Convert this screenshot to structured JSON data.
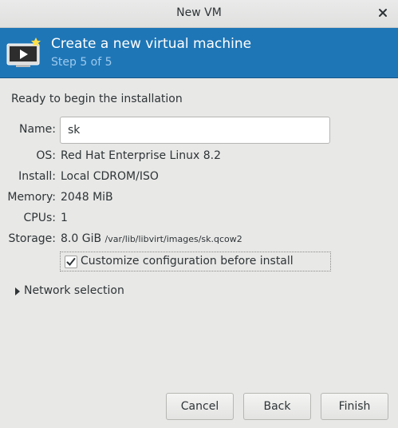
{
  "window": {
    "title": "New VM"
  },
  "banner": {
    "heading": "Create a new virtual machine",
    "step": "Step 5 of 5",
    "icon": "vm-monitor-icon"
  },
  "summary": {
    "ready_text": "Ready to begin the installation",
    "name_label": "Name:",
    "name_value": "sk",
    "os_label": "OS:",
    "os_value": "Red Hat Enterprise Linux 8.2",
    "install_label": "Install:",
    "install_value": "Local CDROM/ISO",
    "memory_label": "Memory:",
    "memory_value": "2048 MiB",
    "cpus_label": "CPUs:",
    "cpus_value": "1",
    "storage_label": "Storage:",
    "storage_value": "8.0 GiB",
    "storage_path": "/var/lib/libvirt/images/sk.qcow2",
    "customize_label": "Customize configuration before install",
    "customize_checked": true,
    "network_label": "Network selection"
  },
  "buttons": {
    "cancel": "Cancel",
    "back": "Back",
    "finish": "Finish"
  },
  "colors": {
    "banner": "#1f76b6",
    "step_text": "#9ccaee",
    "background": "#e8e8e7"
  }
}
